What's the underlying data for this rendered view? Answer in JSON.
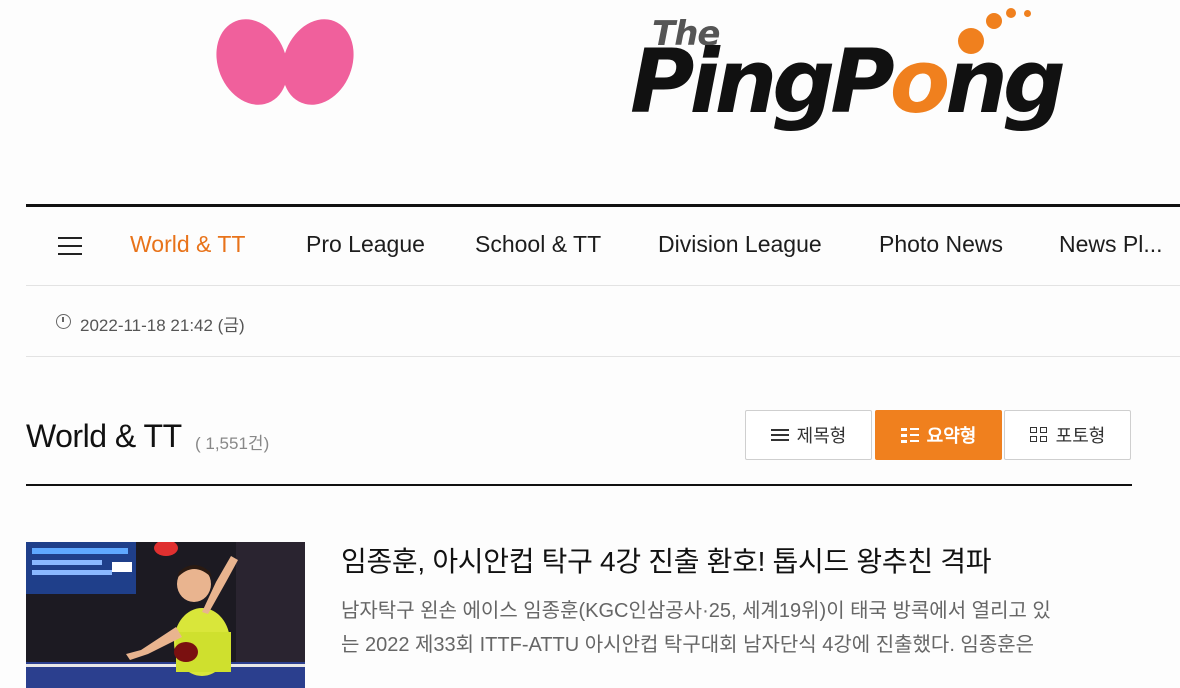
{
  "header": {
    "brand_the": "The",
    "brand_main_prefix": "PingP",
    "brand_main_o": "o",
    "brand_main_suffix": "ng",
    "colors": {
      "accent": "#f0801e",
      "butterfly": "#f0609c"
    }
  },
  "nav": {
    "menu_icon": "hamburger-icon",
    "items": [
      {
        "label": "World & TT",
        "active": true
      },
      {
        "label": "Pro League"
      },
      {
        "label": "School & TT"
      },
      {
        "label": "Division League"
      },
      {
        "label": "Photo News"
      },
      {
        "label": "News Pl..."
      }
    ]
  },
  "article_meta": {
    "date": "2022-11-18 21:42 (금)",
    "icon": "clock-icon"
  },
  "section": {
    "title": "World & TT",
    "count": "( 1,551건)",
    "views": [
      {
        "label": "제목형",
        "icon": "list-icon"
      },
      {
        "label": "요약형",
        "icon": "summary-icon",
        "active": true
      },
      {
        "label": "포토형",
        "icon": "grid-icon"
      }
    ]
  },
  "articles": [
    {
      "title": "임종훈, 아시안컵 탁구 4강 진출 환호! 톱시드 왕추친 격파",
      "summary_line1": "남자탁구 왼손 에이스 임종훈(KGC인삼공사·25, 세계19위)이 태국 방콕에서 열리고 있",
      "summary_line2": "는 2022 제33회 ITTF-ATTU 아시안컵 탁구대회 남자단식 4강에 진출했다. 임종훈은"
    }
  ]
}
